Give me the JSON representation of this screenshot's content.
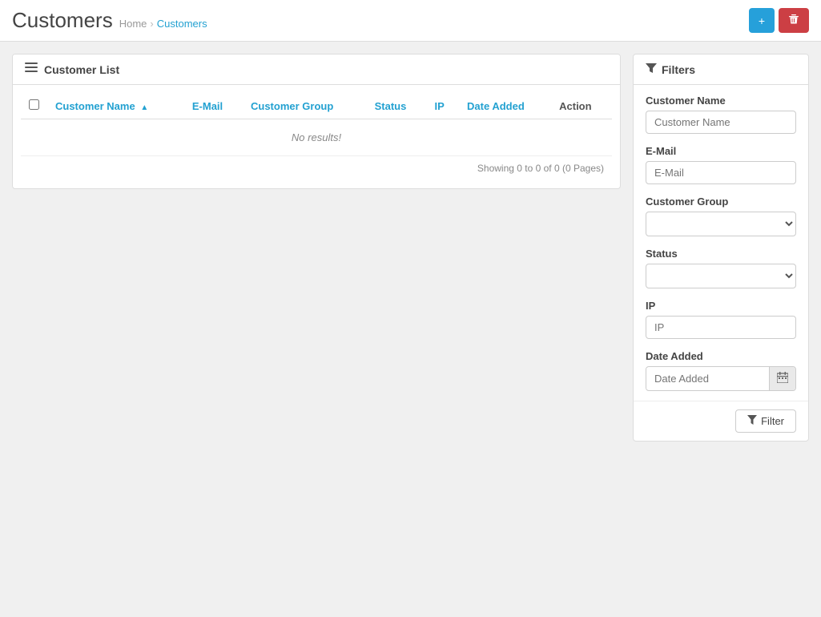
{
  "page": {
    "title": "Customers",
    "breadcrumb": {
      "home": "Home",
      "separator": "›",
      "current": "Customers"
    }
  },
  "header_actions": {
    "add_label": "+",
    "delete_label": "🗑"
  },
  "customer_list": {
    "panel_title": "Customer List",
    "table": {
      "columns": [
        {
          "key": "name",
          "label": "Customer Name",
          "sortable": true
        },
        {
          "key": "email",
          "label": "E-Mail"
        },
        {
          "key": "group",
          "label": "Customer Group"
        },
        {
          "key": "status",
          "label": "Status"
        },
        {
          "key": "ip",
          "label": "IP"
        },
        {
          "key": "date_added",
          "label": "Date Added"
        },
        {
          "key": "action",
          "label": "Action"
        }
      ],
      "no_results": "No results!",
      "rows": []
    },
    "showing_text": "Showing 0 to 0 of 0 (0 Pages)"
  },
  "filters": {
    "panel_title": "Filters",
    "fields": [
      {
        "key": "customer_name",
        "label": "Customer Name",
        "type": "text",
        "placeholder": "Customer Name"
      },
      {
        "key": "email",
        "label": "E-Mail",
        "type": "text",
        "placeholder": "E-Mail"
      },
      {
        "key": "customer_group",
        "label": "Customer Group",
        "type": "select",
        "placeholder": ""
      },
      {
        "key": "status",
        "label": "Status",
        "type": "select",
        "placeholder": ""
      },
      {
        "key": "ip",
        "label": "IP",
        "type": "text",
        "placeholder": "IP"
      },
      {
        "key": "date_added",
        "label": "Date Added",
        "type": "date",
        "placeholder": "Date Added"
      }
    ],
    "filter_button": "Filter"
  }
}
